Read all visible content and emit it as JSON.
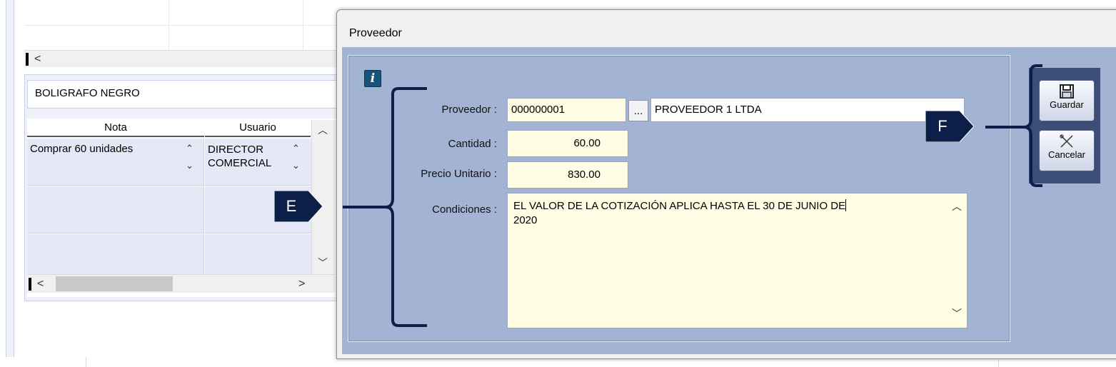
{
  "background_window": {
    "product_name": "BOLIGRAFO NEGRO",
    "notes_table": {
      "columns": [
        "Nota",
        "Usuario"
      ],
      "rows": [
        {
          "nota": "Comprar 60 unidades",
          "usuario_line1": "DIRECTOR",
          "usuario_line2": "COMERCIAL"
        }
      ]
    },
    "scroll_left_glyph": "<",
    "scroll_right_glyph": ">"
  },
  "dialog": {
    "title": "Proveedor",
    "info_glyph": "i",
    "fields": {
      "proveedor": {
        "label": "Proveedor :",
        "code": "000000001",
        "name": "PROVEEDOR 1 LTDA",
        "lookup_label": "..."
      },
      "cantidad": {
        "label": "Cantidad :",
        "value": "60.00"
      },
      "precio_unitario": {
        "label": "Precio Unitario :",
        "value": "830.00"
      },
      "condiciones": {
        "label": "Condiciones :",
        "value_line1": "EL VALOR DE LA COTIZACIÓN APLICA HASTA EL 30 DE JUNIO DE",
        "value_line2": "2020"
      }
    },
    "toolbar": {
      "save_label": "Guardar",
      "cancel_label": "Cancelar"
    }
  },
  "callouts": {
    "e_label": "E",
    "f_label": "F"
  },
  "colors": {
    "dialog_body": "#a3b3d3",
    "toolbar": "#3c4e75",
    "input_fill": "#fffde4",
    "callout": "#0b1f49"
  }
}
